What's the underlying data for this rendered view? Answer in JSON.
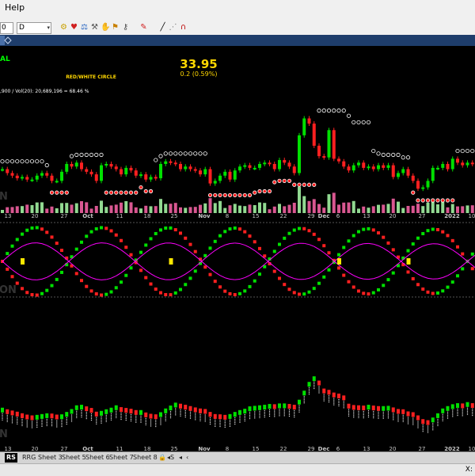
{
  "menu": {
    "help_label": "Help"
  },
  "toolbar": {
    "symbol_value": "0",
    "interval_value": "D"
  },
  "header": {
    "title_fragment": "AL",
    "price": "33.95",
    "change": "0.2 (0.59%)",
    "indicator_label": "RED/WHITE CIRCLE",
    "volume_text": ",900 / Vol(20): 20,689,196 = 68.46 %"
  },
  "panels": {
    "price_tag": "N",
    "osc_tag": "ON",
    "rs_tag": "N"
  },
  "x_axis": {
    "labels": [
      {
        "text": "13",
        "bold": false
      },
      {
        "text": "20",
        "bold": false
      },
      {
        "text": "27",
        "bold": false
      },
      {
        "text": "Oct",
        "bold": true
      },
      {
        "text": "11",
        "bold": false
      },
      {
        "text": "18",
        "bold": false
      },
      {
        "text": "25",
        "bold": false
      },
      {
        "text": "Nov",
        "bold": true
      },
      {
        "text": "8",
        "bold": false
      },
      {
        "text": "15",
        "bold": false
      },
      {
        "text": "22",
        "bold": false
      },
      {
        "text": "29",
        "bold": false
      },
      {
        "text": "Dec",
        "bold": true
      },
      {
        "text": "6",
        "bold": false
      },
      {
        "text": "13",
        "bold": false
      },
      {
        "text": "20",
        "bold": false
      },
      {
        "text": "27",
        "bold": false
      },
      {
        "text": "2022",
        "bold": true
      },
      {
        "text": "10",
        "bold": false
      }
    ]
  },
  "sheet_tabs": [
    "RS",
    "RRG",
    "Sheet 3",
    "Sheet 5",
    "Sheet 6",
    "Sheet 7",
    "Sheet 8"
  ],
  "status": {
    "x_label": "X:"
  },
  "colors": {
    "up": "#00e000",
    "down": "#ff2020",
    "white": "#ffffff",
    "magenta": "#ff00ff",
    "yellow": "#ffe800",
    "axis_text": "#c8c8c8",
    "header_price": "#ffd700",
    "indicator_label": "#ffd700",
    "title_fragment": "#00ff00",
    "vol_up": "#aaffaa",
    "vol_down": "#ff66aa"
  },
  "chart_data": {
    "type": "candlestick",
    "close": [
      24.4,
      24.1,
      23.9,
      23.7,
      23.8,
      23.6,
      23.6,
      23.9,
      24.1,
      23.9,
      23.5,
      23.5,
      24.2,
      24.8,
      24.6,
      24.9,
      24.4,
      24.2,
      24.0,
      23.5,
      24.7,
      24.8,
      24.6,
      24.4,
      24.0,
      24.5,
      24.3,
      23.9,
      24.0,
      23.6,
      23.8,
      23.7,
      24.8,
      25.0,
      24.9,
      24.8,
      24.4,
      24.6,
      24.4,
      24.3,
      24.0,
      24.4,
      23.3,
      23.5,
      23.9,
      24.2,
      23.6,
      24.3,
      24.6,
      24.7,
      24.5,
      24.5,
      24.8,
      24.9,
      24.8,
      24.4,
      25.1,
      24.9,
      24.6,
      24.1,
      27.0,
      28.3,
      27.9,
      26.2,
      25.4,
      25.3,
      27.4,
      25.2,
      25.0,
      24.6,
      24.3,
      24.7,
      24.9,
      24.5,
      24.6,
      24.4,
      24.7,
      24.5,
      24.7,
      23.8,
      24.1,
      24.4,
      23.9,
      23.5,
      22.9,
      23.0,
      23.5,
      24.5,
      24.5,
      24.8,
      24.4,
      25.2,
      24.9,
      24.7,
      24.9,
      24.8,
      25.2
    ]
  }
}
